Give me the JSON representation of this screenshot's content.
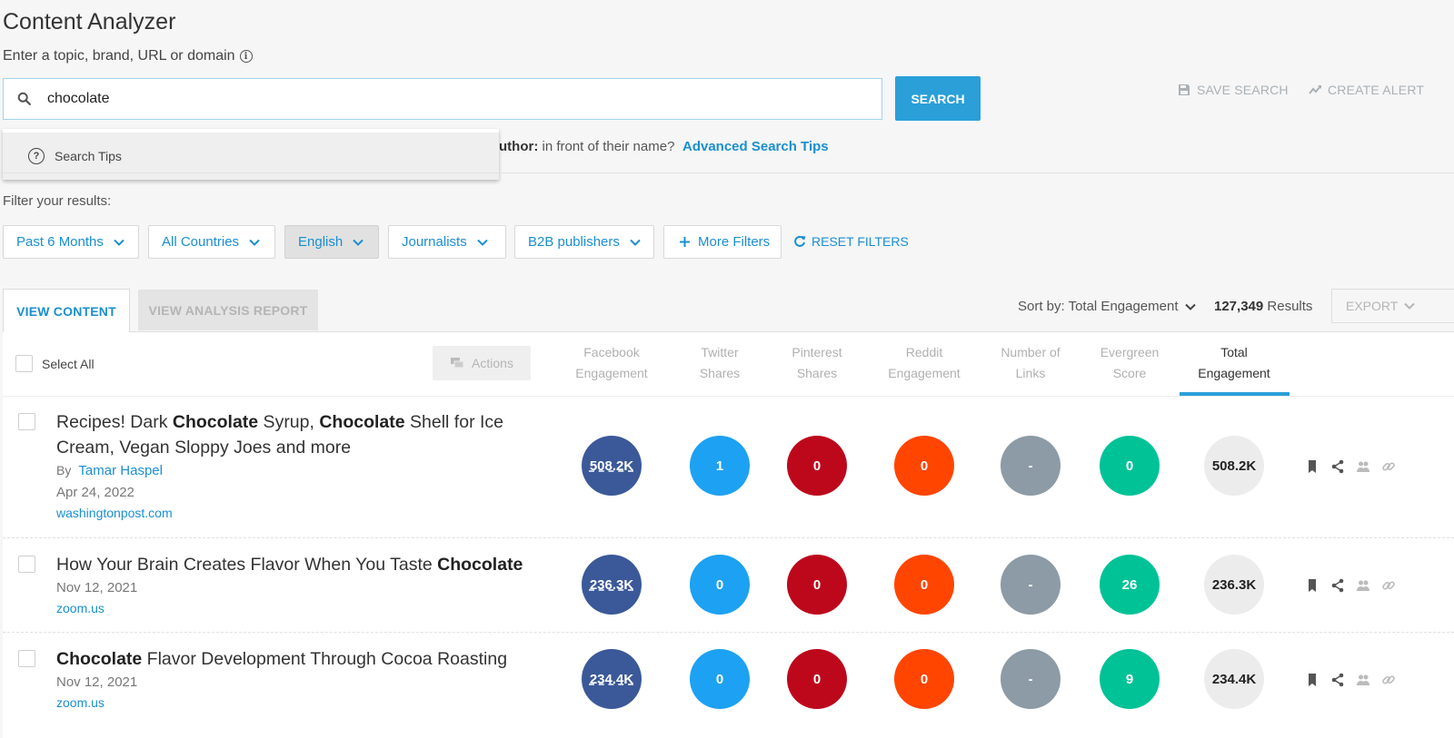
{
  "app": {
    "title": "Content Analyzer",
    "search_label": "Enter a topic, brand, URL or domain"
  },
  "search": {
    "value": "chocolate",
    "button_label": "SEARCH",
    "tips_label": "Search Tips",
    "author_hint_bold": "uthor:",
    "author_hint_rest": " in front of their name?",
    "advanced_tips": "Advanced Search Tips"
  },
  "top_actions": {
    "save_search": "SAVE SEARCH",
    "create_alert": "CREATE ALERT"
  },
  "filters": {
    "label": "Filter your results:",
    "items": [
      {
        "label": "Past 6 Months",
        "active": false
      },
      {
        "label": "All Countries",
        "active": false
      },
      {
        "label": "English",
        "active": true
      },
      {
        "label": "Journalists",
        "active": false
      },
      {
        "label": "B2B publishers",
        "active": false
      }
    ],
    "more_filters": "More Filters",
    "reset": "RESET FILTERS"
  },
  "tabs": {
    "view_content": "VIEW CONTENT",
    "view_analysis": "VIEW ANALYSIS REPORT"
  },
  "results_bar": {
    "sort_label": "Sort by: Total Engagement",
    "count": "127,349",
    "count_suffix": " Results",
    "export": "EXPORT"
  },
  "table": {
    "select_all": "Select All",
    "actions": "Actions",
    "columns": [
      {
        "line1": "Facebook",
        "line2": "Engagement"
      },
      {
        "line1": "Twitter",
        "line2": "Shares"
      },
      {
        "line1": "Pinterest",
        "line2": "Shares"
      },
      {
        "line1": "Reddit",
        "line2": "Engagement"
      },
      {
        "line1": "Number of",
        "line2": "Links"
      },
      {
        "line1": "Evergreen",
        "line2": "Score"
      },
      {
        "line1": "Total",
        "line2": "Engagement"
      }
    ],
    "rows": [
      {
        "title_parts": [
          {
            "t": "Recipes! Dark ",
            "b": false
          },
          {
            "t": "Chocolate",
            "b": true
          },
          {
            "t": " Syrup, ",
            "b": false
          },
          {
            "t": "Chocolate",
            "b": true
          },
          {
            "t": " Shell for Ice Cream, Vegan Sloppy Joes and more",
            "b": false
          }
        ],
        "by_prefix": "By",
        "author": "Tamar Haspel",
        "date": "Apr 24, 2022",
        "domain": "washingtonpost.com",
        "facebook": "508.2K",
        "twitter": "1",
        "pinterest": "0",
        "reddit": "0",
        "links": "-",
        "evergreen": "0",
        "total": "508.2K"
      },
      {
        "title_parts": [
          {
            "t": "How Your Brain Creates Flavor When You Taste ",
            "b": false
          },
          {
            "t": "Chocolate",
            "b": true
          }
        ],
        "by_prefix": "",
        "author": "",
        "date": "Nov 12, 2021",
        "domain": "zoom.us",
        "facebook": "236.3K",
        "twitter": "0",
        "pinterest": "0",
        "reddit": "0",
        "links": "-",
        "evergreen": "26",
        "total": "236.3K"
      },
      {
        "title_parts": [
          {
            "t": "Chocolate",
            "b": true
          },
          {
            "t": " Flavor Development Through Cocoa Roasting",
            "b": false
          }
        ],
        "by_prefix": "",
        "author": "",
        "date": "Nov 12, 2021",
        "domain": "zoom.us",
        "facebook": "234.4K",
        "twitter": "0",
        "pinterest": "0",
        "reddit": "0",
        "links": "-",
        "evergreen": "9",
        "total": "234.4K"
      }
    ]
  },
  "colors": {
    "accent": "#2a9fd8",
    "facebook": "#3b5998",
    "twitter": "#1da1f2",
    "pinterest": "#bd081c",
    "reddit": "#ff4500",
    "links": "#8c9ba5",
    "evergreen": "#00c297"
  }
}
